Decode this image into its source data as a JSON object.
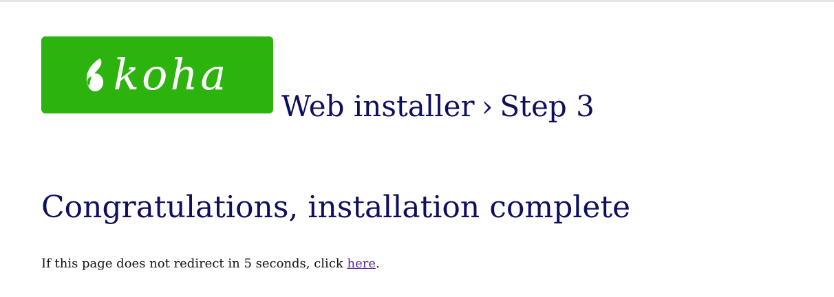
{
  "header": {
    "logo_text": "koha",
    "installer_label": "Web installer",
    "separator": "›",
    "step_label": "Step 3"
  },
  "main": {
    "heading": "Congratulations, installation complete",
    "redirect_prefix": "If this page does not redirect in 5 seconds, click ",
    "redirect_link": "here",
    "redirect_suffix": "."
  },
  "colors": {
    "logo_background": "#2db30e",
    "heading_text": "#0f0f5f",
    "link": "#5a2d8c"
  }
}
